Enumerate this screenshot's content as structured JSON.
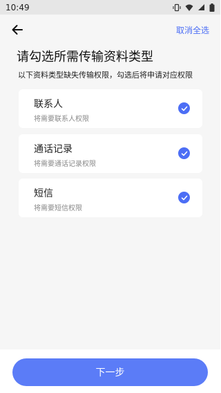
{
  "status": {
    "time": "10:49"
  },
  "header": {
    "cancel_all": "取消全选"
  },
  "page": {
    "title": "请勾选所需传输资料类型",
    "subtitle": "以下资料类型缺失传输权限，勾选后将申请对应权限"
  },
  "items": [
    {
      "title": "联系人",
      "desc": "将需要联系人权限",
      "checked": true
    },
    {
      "title": "通话记录",
      "desc": "将需要通话记录权限",
      "checked": true
    },
    {
      "title": "短信",
      "desc": "将需要短信权限",
      "checked": true
    }
  ],
  "footer": {
    "next_label": "下一步"
  },
  "colors": {
    "accent": "#4c6ef5",
    "button": "#5b7cf7",
    "background": "#f6f6f6"
  },
  "icons": [
    "back-arrow-icon",
    "check-circle-icon",
    "vibrate-icon",
    "wifi-icon",
    "signal-icon",
    "battery-icon"
  ]
}
